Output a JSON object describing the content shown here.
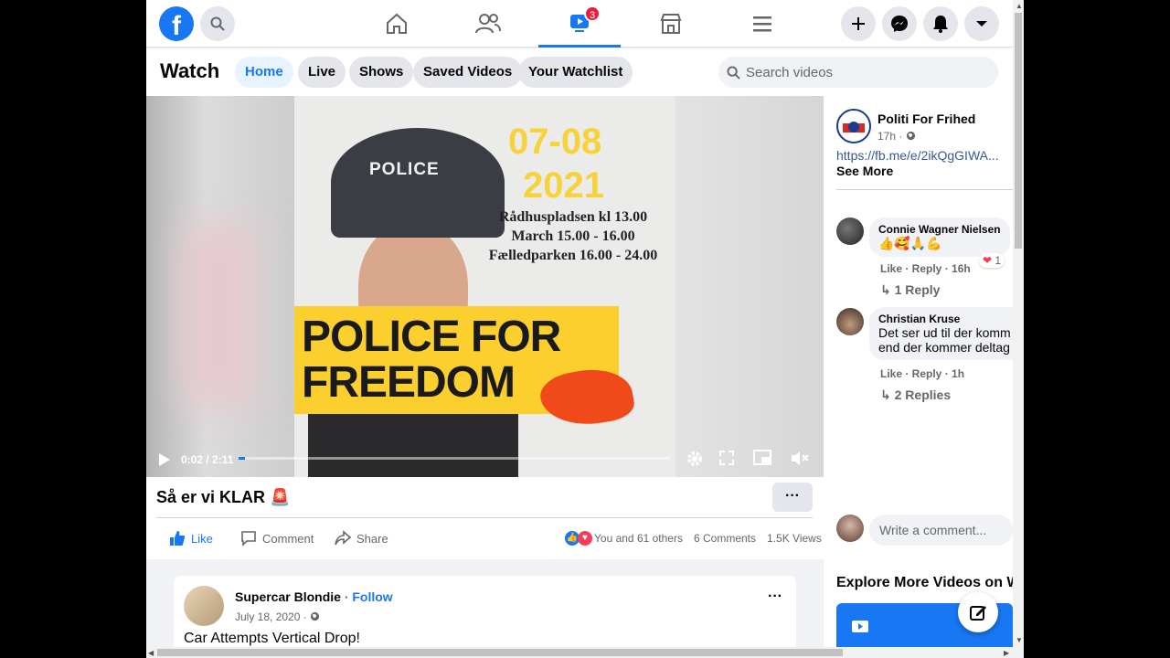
{
  "nav": {
    "logo": "f",
    "notif_badge": "3"
  },
  "watch": {
    "title": "Watch",
    "tabs": [
      "Home",
      "Live",
      "Shows",
      "Saved Videos",
      "Your Watchlist"
    ],
    "active_tab": "Home",
    "search_placeholder": "Search videos"
  },
  "video": {
    "time": "0:02 / 2:11",
    "progress": 0.015,
    "poster": {
      "cap_text": "POLICE",
      "date": "07-08",
      "year": "2021",
      "line1": "Rådhuspladsen kl 13.00",
      "line2": "March 15.00 - 16.00",
      "line3": "Fælledparken 16.00 - 24.00",
      "banner1": "POLICE FOR",
      "banner2": "FREEDOM"
    }
  },
  "post": {
    "title": "Så er vi KLAR 🚨",
    "more": "···",
    "actions": {
      "like": "Like",
      "comment": "Comment",
      "share": "Share"
    },
    "reactions_text": "You and 61 others",
    "comments_count": "6 Comments",
    "views": "1.5K Views"
  },
  "sidebar": {
    "page_name": "Politi For Frihed",
    "time": "17h · ",
    "link": "https://fb.me/e/2ikQgGIWA...",
    "see_more": "See More",
    "comments": [
      {
        "name": "Connie Wagner Nielsen",
        "text": "👍🥰🙏💪",
        "meta": "Like · Reply · 16h",
        "reaction_count": "1",
        "replies": "1 Reply"
      },
      {
        "name": "Christian Kruse",
        "text1": "Det ser ud til der komm",
        "text2": "end der kommer deltag",
        "meta": "Like · Reply · 1h",
        "replies": "2 Replies"
      }
    ],
    "write_placeholder": "Write a comment...",
    "explore": "Explore More Videos on W"
  },
  "next_card": {
    "name": "Supercar Blondie",
    "follow": "Follow",
    "date": "July 18, 2020 · ",
    "title": "Car Attempts Vertical Drop!",
    "more": "···"
  },
  "colors": {
    "brand": "#1877f2",
    "badge": "#e41e3f",
    "poster_yellow": "#fbcf2d"
  }
}
